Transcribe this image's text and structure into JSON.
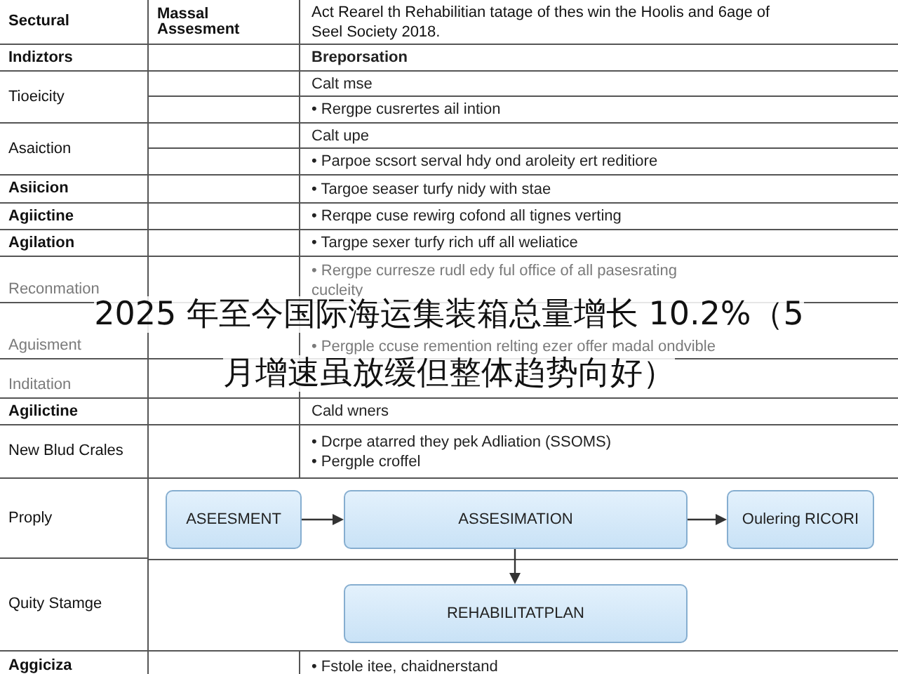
{
  "header": {
    "col1": "Sectural",
    "col2": "Massal Assesment",
    "col3": [
      "Act Rearel th Rehabilitian tatage of thes win the Hoolis and 6age of",
      "Seel Society 2018."
    ]
  },
  "rows": [
    {
      "label": "Indiztors",
      "bold": true,
      "faded": false,
      "cells": [
        {
          "lines": [
            "Breporsation"
          ],
          "bold": true
        }
      ]
    },
    {
      "label": "Tioeicity",
      "bold": false,
      "faded": false,
      "cells": [
        {
          "lines": [
            "Calt mse"
          ],
          "bold": false
        },
        {
          "lines": [
            "• Rergpe cusrertes ail intion"
          ],
          "bold": false
        }
      ]
    },
    {
      "label": "Asaiction",
      "bold": false,
      "faded": false,
      "cells": [
        {
          "lines": [
            "Calt upe"
          ],
          "bold": false
        },
        {
          "lines": [
            "• Parpoe scsort serval hdy ond aroleity ert reditiore"
          ],
          "bold": false
        }
      ]
    },
    {
      "label": "Asiicion",
      "bold": true,
      "faded": false,
      "cells": [
        {
          "lines": [
            "• Targoe seaser turfy nidy with stae"
          ],
          "bold": false
        }
      ]
    },
    {
      "label": "Agiictine",
      "bold": true,
      "faded": false,
      "cells": [
        {
          "lines": [
            "• Rerqpe cuse rewirg cofond all tignes verting"
          ],
          "bold": false
        }
      ]
    },
    {
      "label": "Agilation",
      "bold": true,
      "faded": false,
      "cells": [
        {
          "lines": [
            "• Targpe sexer turfy rich uff all weliatice"
          ],
          "bold": false
        }
      ]
    },
    {
      "label": "Reconmation",
      "bold": false,
      "faded": true,
      "cells": [
        {
          "lines": [
            "• Rergpe curresze rudl edy ful office of all pasesrating",
            "cucleity"
          ],
          "bold": false
        }
      ]
    },
    {
      "label": "Aguisment",
      "bold": false,
      "faded": true,
      "cells": [
        {
          "lines": [
            "• Pergple ccuse remention relting ezer offer madal ondvible"
          ],
          "bold": false
        }
      ]
    },
    {
      "label": "Inditation",
      "bold": false,
      "faded": true,
      "cells": []
    },
    {
      "label": "Agilictine",
      "bold": true,
      "faded": false,
      "cells": [
        {
          "lines": [
            "Cald wners"
          ],
          "bold": false
        }
      ]
    },
    {
      "label": "New Blud Crales",
      "bold": false,
      "faded": false,
      "cells": [
        {
          "lines": [
            "• Dcrpe atarred they pek Adliation (SSOMS)",
            "• Pergple croffel"
          ],
          "bold": false
        }
      ]
    }
  ],
  "diagram": {
    "row_labels": [
      "Proply",
      "Quity Stamge"
    ],
    "nodes": [
      {
        "label": "ASEESMENT"
      },
      {
        "label": "ASSESIMATION"
      },
      {
        "label": "Oulering RICORI"
      },
      {
        "label": "REHABILITATPLAN"
      }
    ]
  },
  "last_row": {
    "label": "Aggiciza",
    "bold": true,
    "cells": [
      {
        "lines": [
          "• Fstole itee, chaidnerstand"
        ],
        "bold": false
      }
    ]
  },
  "title_overlay": {
    "lines": [
      "2025 年至今国际海运集装箱总量增长 10.2%（5",
      "月增速虽放缓但整体趋势向好）"
    ]
  }
}
